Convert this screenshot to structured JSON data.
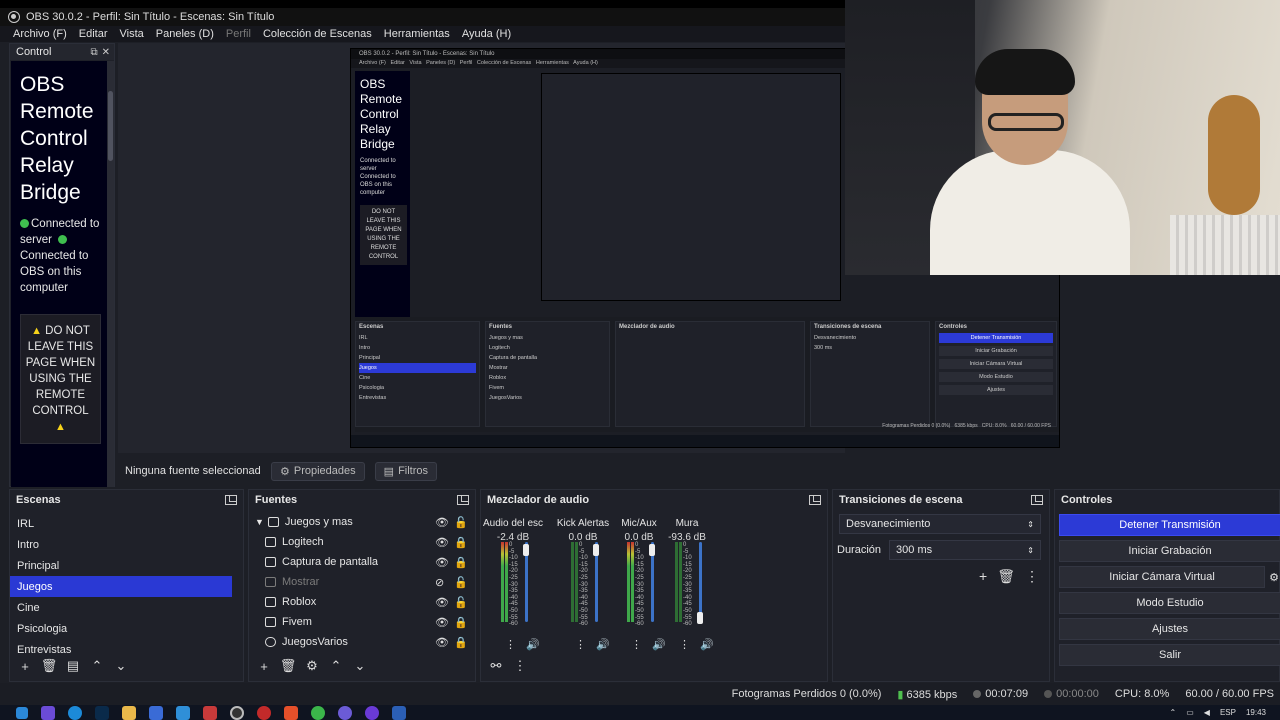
{
  "window": {
    "title": "OBS 30.0.2 - Perfil: Sin Título - Escenas: Sin Título"
  },
  "menu": [
    "Archivo (F)",
    "Editar",
    "Vista",
    "Paneles (D)",
    "Perfil",
    "Colección de Escenas",
    "Herramientas",
    "Ayuda (H)"
  ],
  "control_dock": {
    "title": "Control",
    "heading": "OBS Remote Control Relay Bridge",
    "status1": "Connected to server",
    "status2": "Connected to OBS on this computer",
    "warning": "DO NOT LEAVE THIS PAGE WHEN USING THE REMOTE CONTROL"
  },
  "source_bar": {
    "none_selected": "Ninguna fuente seleccionada",
    "properties": "Propiedades",
    "filters": "Filtros"
  },
  "scenes": {
    "title": "Escenas",
    "items": [
      "IRL",
      "Intro",
      "Principal",
      "Juegos",
      "Cine",
      "Psicologia",
      "Entrevistas"
    ],
    "selected": "Juegos"
  },
  "sources": {
    "title": "Fuentes",
    "items": [
      "Juegos y mas",
      "Logitech",
      "Captura de pantalla",
      "Mostrar",
      "Roblox",
      "Fivem",
      "JuegosVarios"
    ]
  },
  "mixer": {
    "title": "Mezclador de audio",
    "channels": [
      {
        "name": "Audio del escritorio",
        "db": "-2.4 dB",
        "level": 0.85
      },
      {
        "name": "Kick Alertas",
        "db": "0.0 dB",
        "level": 0.0
      },
      {
        "name": "Mic/Aux",
        "db": "0.0 dB",
        "level": 0.95
      },
      {
        "name": "Mura",
        "db": "-93.6 dB",
        "level": 0.0
      }
    ],
    "scale": [
      "0",
      "-5",
      "-10",
      "-15",
      "-20",
      "-25",
      "-30",
      "-35",
      "-40",
      "-45",
      "-50",
      "-55",
      "-60"
    ]
  },
  "transitions": {
    "title": "Transiciones de escena",
    "selected": "Desvanecimiento",
    "duration_label": "Duración",
    "duration_value": "300 ms"
  },
  "controls": {
    "title": "Controles",
    "buttons": [
      "Detener Transmisión",
      "Iniciar Grabación",
      "Iniciar Cámara Virtual",
      "Modo Estudio",
      "Ajustes",
      "Salir"
    ]
  },
  "statusbar": {
    "dropped": "Fotogramas Perdidos 0 (0.0%)",
    "bitrate": "6385 kbps",
    "stream_time": "00:07:09",
    "rec_time": "00:00:00",
    "cpu": "CPU: 8.0%",
    "fps": "60.00 / 60.00 FPS"
  },
  "taskbar": {
    "lang": "ESP",
    "time": "19:43"
  },
  "colors": {
    "accent": "#2a39d4",
    "ok": "#3fbf4f",
    "warn": "#f7d31a"
  }
}
